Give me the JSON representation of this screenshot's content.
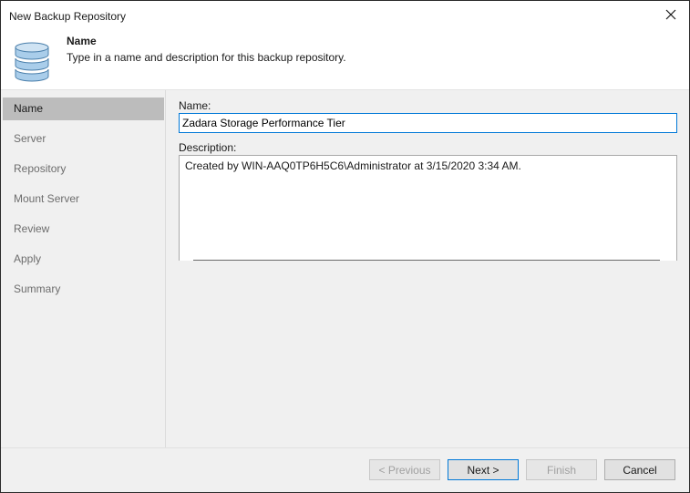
{
  "window": {
    "title": "New Backup Repository"
  },
  "header": {
    "title": "Name",
    "description": "Type in a name and description for this backup repository."
  },
  "sidebar": {
    "items": [
      {
        "label": "Name",
        "active": true
      },
      {
        "label": "Server",
        "active": false
      },
      {
        "label": "Repository",
        "active": false
      },
      {
        "label": "Mount Server",
        "active": false
      },
      {
        "label": "Review",
        "active": false
      },
      {
        "label": "Apply",
        "active": false
      },
      {
        "label": "Summary",
        "active": false
      }
    ]
  },
  "form": {
    "name_label": "Name:",
    "name_value": "Zadara Storage Performance Tier",
    "description_label": "Description:",
    "description_value": "Created by WIN-AAQ0TP6H5C6\\Administrator at 3/15/2020 3:34 AM."
  },
  "footer": {
    "previous_label": "< Previous",
    "next_label": "Next >",
    "finish_label": "Finish",
    "cancel_label": "Cancel"
  },
  "icons": {
    "header": "database-icon",
    "close": "close-icon"
  },
  "colors": {
    "accent": "#0078d7",
    "active_step": "#bcbcbc",
    "db_icon": "#a9cdea"
  }
}
